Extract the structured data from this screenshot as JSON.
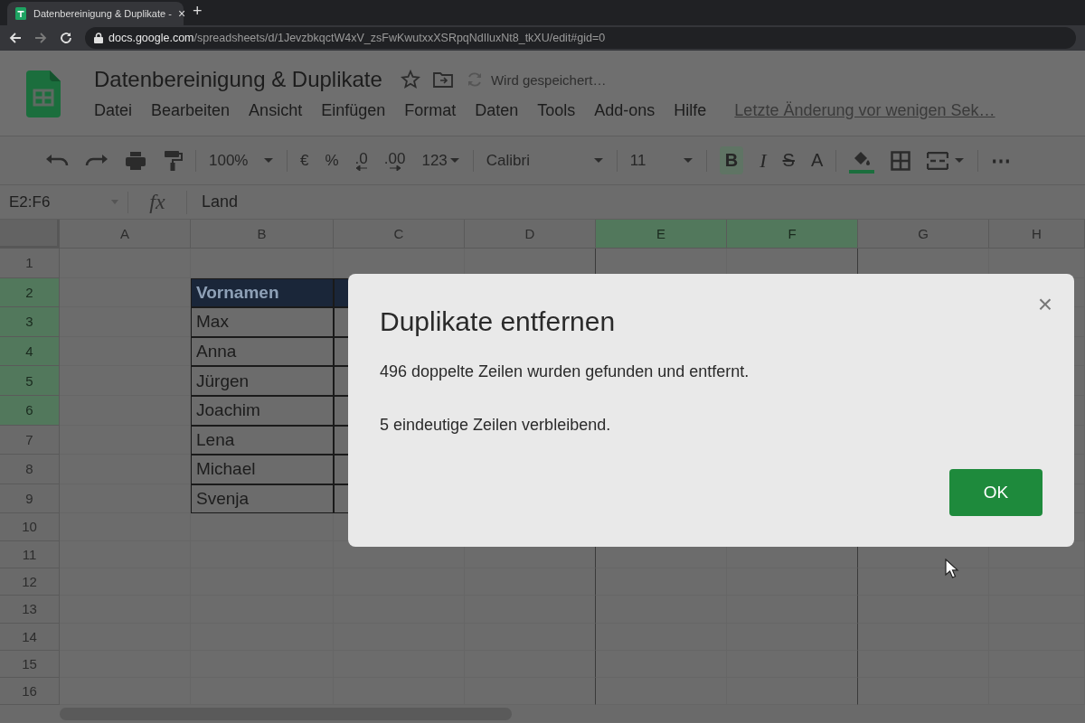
{
  "browser": {
    "tab_title": "Datenbereinigung & Duplikate -",
    "tab_close": "×",
    "new_tab": "+",
    "url_host": "docs.google.com",
    "url_path": "/spreadsheets/d/1JevzbkqctW4xV_zsFwKwutxxXSRpqNdIluxNt8_tkXU/edit#gid=0"
  },
  "document": {
    "title": "Datenbereinigung & Duplikate",
    "save_status": "Wird gespeichert…",
    "menu": [
      "Datei",
      "Bearbeiten",
      "Ansicht",
      "Einfügen",
      "Format",
      "Daten",
      "Tools",
      "Add-ons",
      "Hilfe"
    ],
    "last_edit": "Letzte Änderung vor wenigen Sek…"
  },
  "toolbar": {
    "zoom": "100%",
    "currency": "€",
    "percent": "%",
    "decimal_less": ".0",
    "decimal_more": ".00",
    "number_format": "123",
    "font": "Calibri",
    "font_size": "11",
    "bold": {
      "label": "B",
      "on": true
    },
    "italic": "I",
    "strikethrough": "S",
    "text_color": "A",
    "more": "⋯"
  },
  "formula_bar": {
    "name_box": "E2:F6",
    "fx": "fx",
    "content": "Land"
  },
  "grid": {
    "columns": [
      {
        "label": "A",
        "selected": false
      },
      {
        "label": "B",
        "selected": false
      },
      {
        "label": "C",
        "selected": false
      },
      {
        "label": "D",
        "selected": false
      },
      {
        "label": "E",
        "selected": true
      },
      {
        "label": "F",
        "selected": true
      },
      {
        "label": "G",
        "selected": false
      },
      {
        "label": "H",
        "selected": false
      }
    ],
    "rows": [
      {
        "label": "1",
        "selected": false
      },
      {
        "label": "2",
        "selected": true
      },
      {
        "label": "3",
        "selected": true
      },
      {
        "label": "4",
        "selected": true
      },
      {
        "label": "5",
        "selected": true
      },
      {
        "label": "6",
        "selected": true
      },
      {
        "label": "7",
        "selected": false
      },
      {
        "label": "8",
        "selected": false
      },
      {
        "label": "9",
        "selected": false
      },
      {
        "label": "10",
        "selected": false
      },
      {
        "label": "11",
        "selected": false
      },
      {
        "label": "12",
        "selected": false
      },
      {
        "label": "13",
        "selected": false
      },
      {
        "label": "14",
        "selected": false
      },
      {
        "label": "15",
        "selected": false
      },
      {
        "label": "16",
        "selected": false
      }
    ],
    "table": {
      "header": "Vornamen",
      "cells": [
        "Max",
        "Anna",
        "Jürgen",
        "Joachim",
        "Lena",
        "Michael",
        "Svenja"
      ]
    }
  },
  "dialog": {
    "title": "Duplikate entfernen",
    "close": "×",
    "lines": [
      "496 doppelte Zeilen wurden gefunden und entfernt.",
      "5 eindeutige Zeilen verbleibend."
    ],
    "ok": "OK"
  }
}
